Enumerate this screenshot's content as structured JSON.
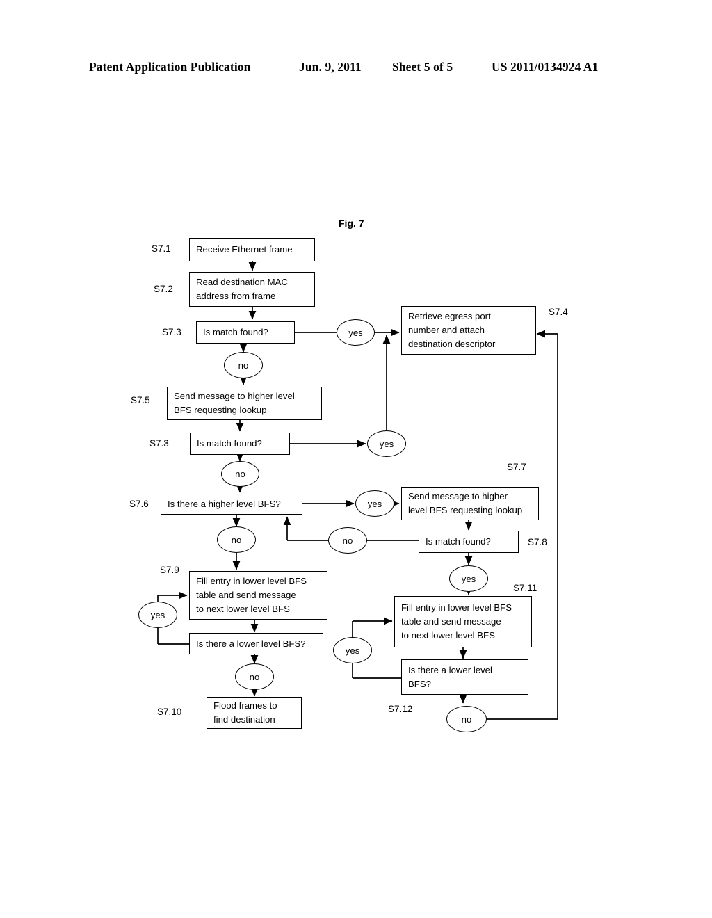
{
  "header": {
    "publication": "Patent Application Publication",
    "date": "Jun. 9, 2011",
    "sheet": "Sheet 5 of 5",
    "number": "US 2011/0134924 A1"
  },
  "figure": {
    "title": "Fig. 7",
    "nodes": {
      "s7_1": "Receive Ethernet frame",
      "s7_2": "Read destination MAC\naddress from frame",
      "s7_3a": "Is match found?",
      "s7_4": "Retrieve egress port\nnumber and attach\ndestination descriptor",
      "s7_5": "Send message to higher level\nBFS requesting lookup",
      "s7_3b": "Is match found?",
      "s7_6": "Is there a higher level BFS?",
      "s7_7": "Send message to higher\nlevel BFS requesting lookup",
      "s7_8": "Is match found?",
      "s7_9": "Fill entry in lower level BFS\ntable and send message\nto next lower level BFS",
      "s7_9_decision": "Is there a lower level BFS?",
      "s7_10": "Flood frames to\nfind destination",
      "s7_11": "Fill entry in lower level BFS\ntable and send message\nto next lower level BFS",
      "s7_12_decision": "Is there a lower level\nBFS?"
    },
    "branches": {
      "yes_s7_3a": "yes",
      "no_s7_3a": "no",
      "yes_s7_3b": "yes",
      "no_s7_3b": "no",
      "yes_s7_6": "yes",
      "no_s7_6": "no",
      "no_s7_8": "no",
      "yes_s7_8": "yes",
      "yes_s7_9": "yes",
      "no_s7_9": "no",
      "yes_s7_11": "yes",
      "no_s7_12": "no"
    },
    "step_labels": {
      "s7_1": "S7.1",
      "s7_2": "S7.2",
      "s7_3a": "S7.3",
      "s7_4": "S7.4",
      "s7_5": "S7.5",
      "s7_3b": "S7.3",
      "s7_6": "S7.6",
      "s7_7": "S7.7",
      "s7_8": "S7.8",
      "s7_9": "S7.9",
      "s7_10": "S7.10",
      "s7_11": "S7.11",
      "s7_12": "S7.12"
    }
  }
}
